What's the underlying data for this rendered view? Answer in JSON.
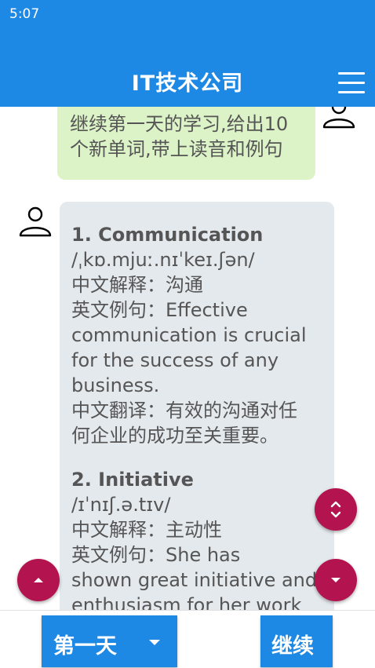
{
  "status_bar": {
    "time": "5:07"
  },
  "app_bar": {
    "title": "IT技术公司",
    "menu_icon": "hamburger-menu-icon"
  },
  "chat": {
    "user_message": {
      "lines": [
        "继续第一天的学习,给出10",
        "个新单词,带上读音和例句"
      ]
    },
    "bot_message": {
      "entries": [
        {
          "word": "1. Communication",
          "phonetic": "/ˌkɒ.mjuː.nɪˈkeɪ.ʃən/",
          "meaning": "中文解释：沟通",
          "example_lines": [
            "英文例句：Effective",
            "communication is crucial",
            "for the success of any",
            "business."
          ],
          "translation_lines": [
            "中文翻译：有效的沟通对任",
            "何企业的成功至关重要。"
          ]
        },
        {
          "word": "2. Initiative",
          "phonetic": "/ɪˈnɪʃ.ə.tɪv/",
          "meaning": "中文解释：主动性",
          "example_lines": [
            "英文例句：She has",
            "shown great initiative and",
            "enthusiasm for her work"
          ]
        }
      ]
    }
  },
  "bottom_bar": {
    "day_select": "第一天",
    "continue_button": "继续"
  },
  "colors": {
    "primary": "#1e88e5",
    "accent": "#b3144f",
    "user_bubble": "#dcf3c7",
    "bot_bubble": "#e4e9ee"
  }
}
